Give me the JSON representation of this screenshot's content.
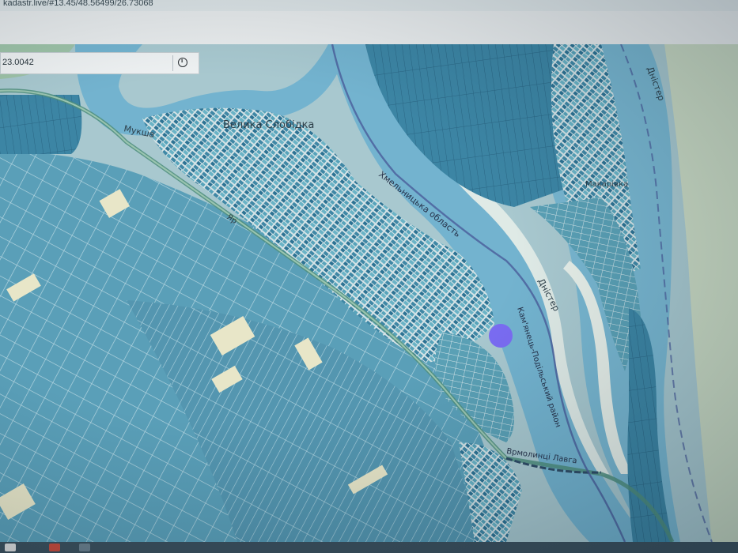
{
  "browser": {
    "url": "kadastr.live/#13.45/48.56499/26.73068"
  },
  "coordinates": {
    "value": "23.0042"
  },
  "map": {
    "labels": {
      "village": "Велика Слобідка",
      "river_small": "Мукша",
      "region": "Хмельницька область",
      "river_main_1": "Дністер",
      "river_main_2": "Дністер",
      "road": "Кам'янець-Подільський район",
      "village_right": "Макарівка",
      "bottom_road": "Врмолинці Лавга",
      "street": "Яр"
    },
    "colors": {
      "river": "#6fb2cf",
      "parcel": "#4e97b0",
      "parcel_dark": "#2f7896",
      "land": "#a9c9cf",
      "location_dot": "#7a6cf2"
    }
  }
}
